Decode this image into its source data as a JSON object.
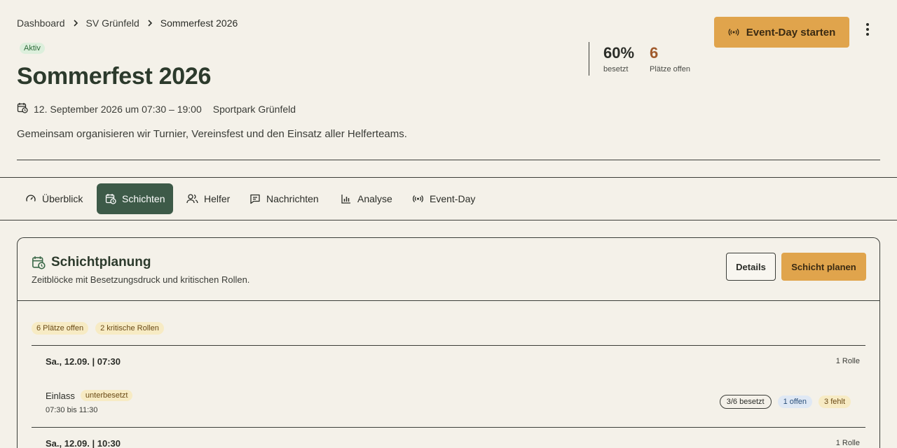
{
  "breadcrumb": {
    "items": [
      "Dashboard",
      "SV Grünfeld"
    ],
    "current": "Sommerfest 2026"
  },
  "event": {
    "status": "Aktiv",
    "title": "Sommerfest 2026",
    "datetime": "12. September 2026 um 07:30 – 19:00",
    "location": "Sportpark Grünfeld",
    "description": "Gemeinsam organisieren wir Turnier, Vereinsfest und den Einsatz aller Helferteams."
  },
  "stats": {
    "occupancy_value": "60%",
    "occupancy_label": "besetzt",
    "open_value": "6",
    "open_label": "Plätze offen"
  },
  "actions": {
    "event_day_label": "Event-Day starten"
  },
  "tabs": [
    {
      "label": "Überblick",
      "icon": "gauge-icon",
      "active": false
    },
    {
      "label": "Schichten",
      "icon": "calendar-clock-icon",
      "active": true
    },
    {
      "label": "Helfer",
      "icon": "users-icon",
      "active": false
    },
    {
      "label": "Nachrichten",
      "icon": "message-icon",
      "active": false
    },
    {
      "label": "Analyse",
      "icon": "bar-chart-icon",
      "active": false
    },
    {
      "label": "Event-Day",
      "icon": "broadcast-icon",
      "active": false
    }
  ],
  "planning": {
    "title": "Schichtplanung",
    "subtitle": "Zeitblöcke mit Besetzungsdruck und kritischen Rollen.",
    "details_label": "Details",
    "plan_label": "Schicht planen",
    "chips": [
      "6 Plätze offen",
      "2 kritische Rollen"
    ],
    "slots": [
      {
        "date": "Sa., 12.09. | 07:30",
        "count": "1 Rolle",
        "shift": {
          "name": "Einlass",
          "tag": "unterbesetzt",
          "time": "07:30 bis 11:30",
          "filled": "3/6 besetzt",
          "open": "1 offen",
          "missing": "3 fehlt"
        }
      },
      {
        "date": "Sa., 12.09. | 10:30",
        "count": "1 Rolle"
      }
    ]
  },
  "colors": {
    "background": "#f4f1e9",
    "accent": "#e0a44c",
    "active_tab": "#3d5a48",
    "title": "#2c3a2c"
  }
}
